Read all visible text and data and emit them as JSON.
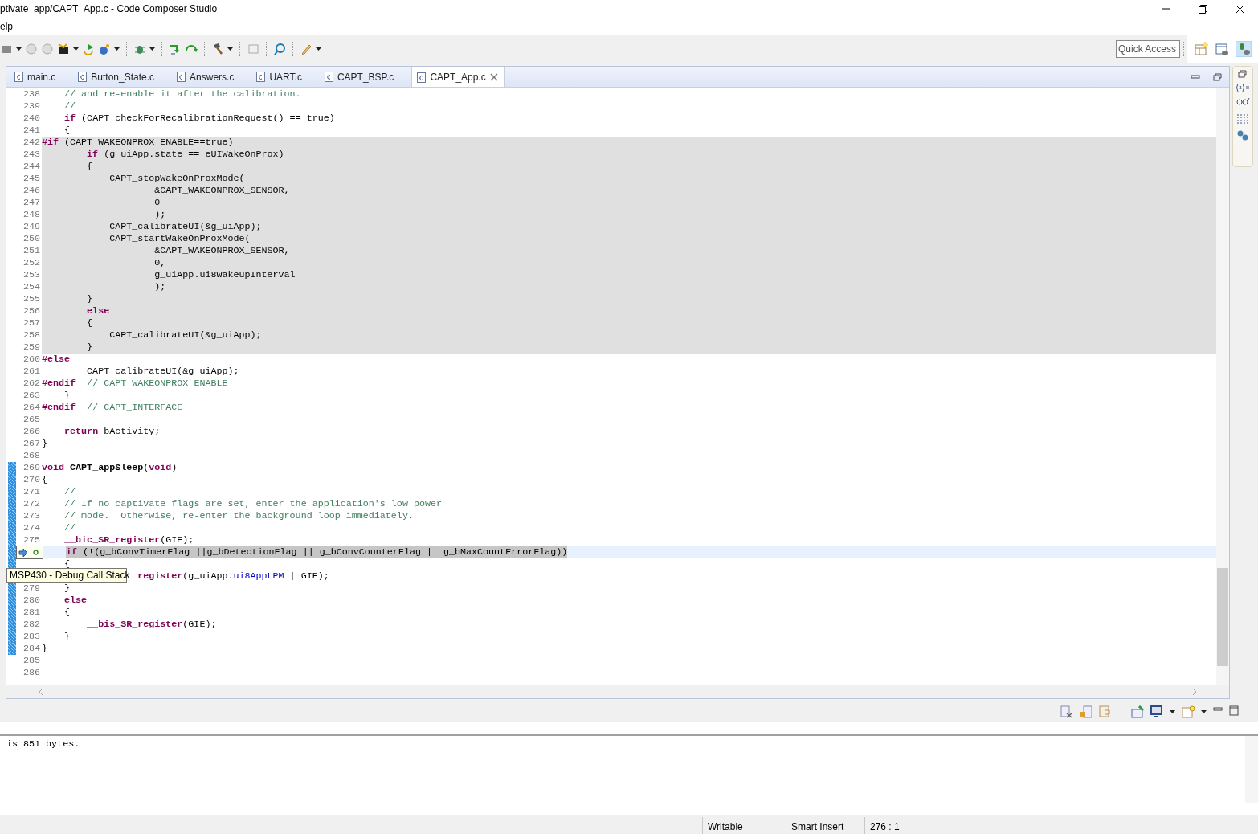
{
  "window": {
    "title": "ptivate_app/CAPT_App.c - Code Composer Studio"
  },
  "menu": [
    {
      "label": "elp"
    }
  ],
  "quick_access": {
    "placeholder": "Quick Access"
  },
  "editor": {
    "tabs": [
      {
        "label": "main.c",
        "selected": false
      },
      {
        "label": "Button_State.c",
        "selected": false
      },
      {
        "label": "Answers.c",
        "selected": false
      },
      {
        "label": "UART.c",
        "selected": false
      },
      {
        "label": "CAPT_BSP.c",
        "selected": false
      },
      {
        "label": "CAPT_App.c",
        "selected": true
      }
    ],
    "lines": [
      {
        "number": "238",
        "changed": false,
        "inactive": false,
        "current": false,
        "segments": [
          {
            "kind": "cm",
            "text": "    // and re-enable it after the calibration."
          }
        ]
      },
      {
        "number": "239",
        "changed": false,
        "inactive": false,
        "current": false,
        "segments": [
          {
            "kind": "cm",
            "text": "    //"
          }
        ]
      },
      {
        "number": "240",
        "changed": false,
        "inactive": false,
        "current": false,
        "segments": [
          {
            "kind": "kw",
            "text": "    if"
          },
          {
            "kind": "tx",
            "text": " (CAPT_checkForRecalibrationRequest() == true)"
          }
        ]
      },
      {
        "number": "241",
        "changed": false,
        "inactive": false,
        "current": false,
        "segments": [
          {
            "kind": "tx",
            "text": "    {"
          }
        ]
      },
      {
        "number": "242",
        "changed": false,
        "inactive": true,
        "current": false,
        "segments": [
          {
            "kind": "pp",
            "text": "#if"
          },
          {
            "kind": "tx",
            "text": " (CAPT_WAKEONPROX_ENABLE==true)"
          }
        ]
      },
      {
        "number": "243",
        "changed": false,
        "inactive": true,
        "current": false,
        "segments": [
          {
            "kind": "kw",
            "text": "        if"
          },
          {
            "kind": "tx",
            "text": " (g_uiApp.state == eUIWakeOnProx)"
          }
        ]
      },
      {
        "number": "244",
        "changed": false,
        "inactive": true,
        "current": false,
        "segments": [
          {
            "kind": "tx",
            "text": "        {"
          }
        ]
      },
      {
        "number": "245",
        "changed": false,
        "inactive": true,
        "current": false,
        "segments": [
          {
            "kind": "tx",
            "text": "            CAPT_stopWakeOnProxMode("
          }
        ]
      },
      {
        "number": "246",
        "changed": false,
        "inactive": true,
        "current": false,
        "segments": [
          {
            "kind": "tx",
            "text": "                    &CAPT_WAKEONPROX_SENSOR,"
          }
        ]
      },
      {
        "number": "247",
        "changed": false,
        "inactive": true,
        "current": false,
        "segments": [
          {
            "kind": "tx",
            "text": "                    0"
          }
        ]
      },
      {
        "number": "248",
        "changed": false,
        "inactive": true,
        "current": false,
        "segments": [
          {
            "kind": "tx",
            "text": "                    );"
          }
        ]
      },
      {
        "number": "249",
        "changed": false,
        "inactive": true,
        "current": false,
        "segments": [
          {
            "kind": "tx",
            "text": "            CAPT_calibrateUI(&g_uiApp);"
          }
        ]
      },
      {
        "number": "250",
        "changed": false,
        "inactive": true,
        "current": false,
        "segments": [
          {
            "kind": "tx",
            "text": "            CAPT_startWakeOnProxMode("
          }
        ]
      },
      {
        "number": "251",
        "changed": false,
        "inactive": true,
        "current": false,
        "segments": [
          {
            "kind": "tx",
            "text": "                    &CAPT_WAKEONPROX_SENSOR,"
          }
        ]
      },
      {
        "number": "252",
        "changed": false,
        "inactive": true,
        "current": false,
        "segments": [
          {
            "kind": "tx",
            "text": "                    0,"
          }
        ]
      },
      {
        "number": "253",
        "changed": false,
        "inactive": true,
        "current": false,
        "segments": [
          {
            "kind": "tx",
            "text": "                    g_uiApp.ui8WakeupInterval"
          }
        ]
      },
      {
        "number": "254",
        "changed": false,
        "inactive": true,
        "current": false,
        "segments": [
          {
            "kind": "tx",
            "text": "                    );"
          }
        ]
      },
      {
        "number": "255",
        "changed": false,
        "inactive": true,
        "current": false,
        "segments": [
          {
            "kind": "tx",
            "text": "        }"
          }
        ]
      },
      {
        "number": "256",
        "changed": false,
        "inactive": true,
        "current": false,
        "segments": [
          {
            "kind": "kw",
            "text": "        else"
          }
        ]
      },
      {
        "number": "257",
        "changed": false,
        "inactive": true,
        "current": false,
        "segments": [
          {
            "kind": "tx",
            "text": "        {"
          }
        ]
      },
      {
        "number": "258",
        "changed": false,
        "inactive": true,
        "current": false,
        "segments": [
          {
            "kind": "tx",
            "text": "            CAPT_calibrateUI(&g_uiApp);"
          }
        ]
      },
      {
        "number": "259",
        "changed": false,
        "inactive": true,
        "current": false,
        "segments": [
          {
            "kind": "tx",
            "text": "        }"
          }
        ]
      },
      {
        "number": "260",
        "changed": false,
        "inactive": false,
        "current": false,
        "segments": [
          {
            "kind": "pp",
            "text": "#else"
          }
        ]
      },
      {
        "number": "261",
        "changed": false,
        "inactive": false,
        "current": false,
        "segments": [
          {
            "kind": "tx",
            "text": "        CAPT_calibrateUI(&g_uiApp);"
          }
        ]
      },
      {
        "number": "262",
        "changed": false,
        "inactive": false,
        "current": false,
        "segments": [
          {
            "kind": "pp",
            "text": "#endif"
          },
          {
            "kind": "cm",
            "text": "  // CAPT_WAKEONPROX_ENABLE"
          }
        ]
      },
      {
        "number": "263",
        "changed": false,
        "inactive": false,
        "current": false,
        "segments": [
          {
            "kind": "tx",
            "text": "    }"
          }
        ]
      },
      {
        "number": "264",
        "changed": false,
        "inactive": false,
        "current": false,
        "segments": [
          {
            "kind": "pp",
            "text": "#endif"
          },
          {
            "kind": "cm",
            "text": "  // CAPT_INTERFACE"
          }
        ]
      },
      {
        "number": "265",
        "changed": false,
        "inactive": false,
        "current": false
      },
      {
        "number": "266",
        "changed": false,
        "inactive": false,
        "current": false,
        "segments": [
          {
            "kind": "kw",
            "text": "    return"
          },
          {
            "kind": "tx",
            "text": " bActivity;"
          }
        ]
      },
      {
        "number": "267",
        "changed": false,
        "inactive": false,
        "current": false,
        "segments": [
          {
            "kind": "tx",
            "text": "}"
          }
        ]
      },
      {
        "number": "268",
        "changed": false,
        "inactive": false,
        "current": false
      },
      {
        "number": "269",
        "changed": true,
        "inactive": false,
        "current": false,
        "segments": [
          {
            "kind": "kw",
            "text": "void"
          },
          {
            "kind": "fn",
            "text": " CAPT_appSleep"
          },
          {
            "kind": "tx",
            "text": "("
          },
          {
            "kind": "kw",
            "text": "void"
          },
          {
            "kind": "tx",
            "text": ")"
          }
        ]
      },
      {
        "number": "270",
        "changed": true,
        "inactive": false,
        "current": false,
        "segments": [
          {
            "kind": "tx",
            "text": "{"
          }
        ]
      },
      {
        "number": "271",
        "changed": true,
        "inactive": false,
        "current": false,
        "segments": [
          {
            "kind": "cm",
            "text": "    //"
          }
        ]
      },
      {
        "number": "272",
        "changed": true,
        "inactive": false,
        "current": false,
        "segments": [
          {
            "kind": "cm",
            "text": "    // If no captivate flags are set, enter the application's low power"
          }
        ]
      },
      {
        "number": "273",
        "changed": true,
        "inactive": false,
        "current": false,
        "segments": [
          {
            "kind": "cm",
            "text": "    // mode.  Otherwise, re-enter the background loop immediately."
          }
        ]
      },
      {
        "number": "274",
        "changed": true,
        "inactive": false,
        "current": false,
        "segments": [
          {
            "kind": "cm",
            "text": "    //"
          }
        ]
      },
      {
        "number": "275",
        "changed": true,
        "inactive": false,
        "current": false,
        "segments": [
          {
            "kind": "kw",
            "text": "    __bic_SR_register"
          },
          {
            "kind": "tx",
            "text": "(GIE);"
          }
        ]
      },
      {
        "changed": true,
        "inactive": false,
        "current": true,
        "segments": [
          {
            "kind": "kw",
            "text": "    if"
          },
          {
            "kind": "tx",
            "text": " (!(g_bConvTimerFlag ||g_bDetectionFlag || g_bConvCounterFlag || g_bMaxCountErrorFlag))"
          }
        ]
      },
      {
        "changed": true,
        "inactive": false,
        "current": false,
        "segments": [
          {
            "kind": "tx",
            "text": "    {"
          }
        ]
      },
      {
        "inactive": false,
        "current": false,
        "segments": [
          {
            "kind": "kw",
            "text": "                 register"
          },
          {
            "kind": "tx",
            "text": "(g_uiApp."
          },
          {
            "kind": "fd",
            "text": "ui8AppLPM"
          },
          {
            "kind": "tx",
            "text": " | GIE);"
          }
        ]
      },
      {
        "number": "279",
        "changed": true,
        "inactive": false,
        "current": false,
        "segments": [
          {
            "kind": "tx",
            "text": "    }"
          }
        ]
      },
      {
        "number": "280",
        "changed": true,
        "inactive": false,
        "current": false,
        "segments": [
          {
            "kind": "kw",
            "text": "    else"
          }
        ]
      },
      {
        "number": "281",
        "changed": true,
        "inactive": false,
        "current": false,
        "segments": [
          {
            "kind": "tx",
            "text": "    {"
          }
        ]
      },
      {
        "number": "282",
        "changed": true,
        "inactive": false,
        "current": false,
        "segments": [
          {
            "kind": "kw",
            "text": "        __bis_SR_register"
          },
          {
            "kind": "tx",
            "text": "(GIE);"
          }
        ]
      },
      {
        "number": "283",
        "changed": true,
        "inactive": false,
        "current": false,
        "segments": [
          {
            "kind": "tx",
            "text": "    }"
          }
        ]
      },
      {
        "number": "284",
        "changed": true,
        "inactive": false,
        "current": false,
        "segments": [
          {
            "kind": "tx",
            "text": "}"
          }
        ]
      },
      {
        "number": "285",
        "changed": false,
        "inactive": false,
        "current": false
      },
      {
        "number": "286",
        "changed": false,
        "inactive": false,
        "current": false
      }
    ],
    "tooltip": "MSP430 - Debug Call Stack"
  },
  "console": {
    "lines": [
      "is 851 bytes."
    ]
  },
  "status_bar": {
    "mode": "Writable",
    "insert": "Smart Insert",
    "position": "276 : 1"
  }
}
